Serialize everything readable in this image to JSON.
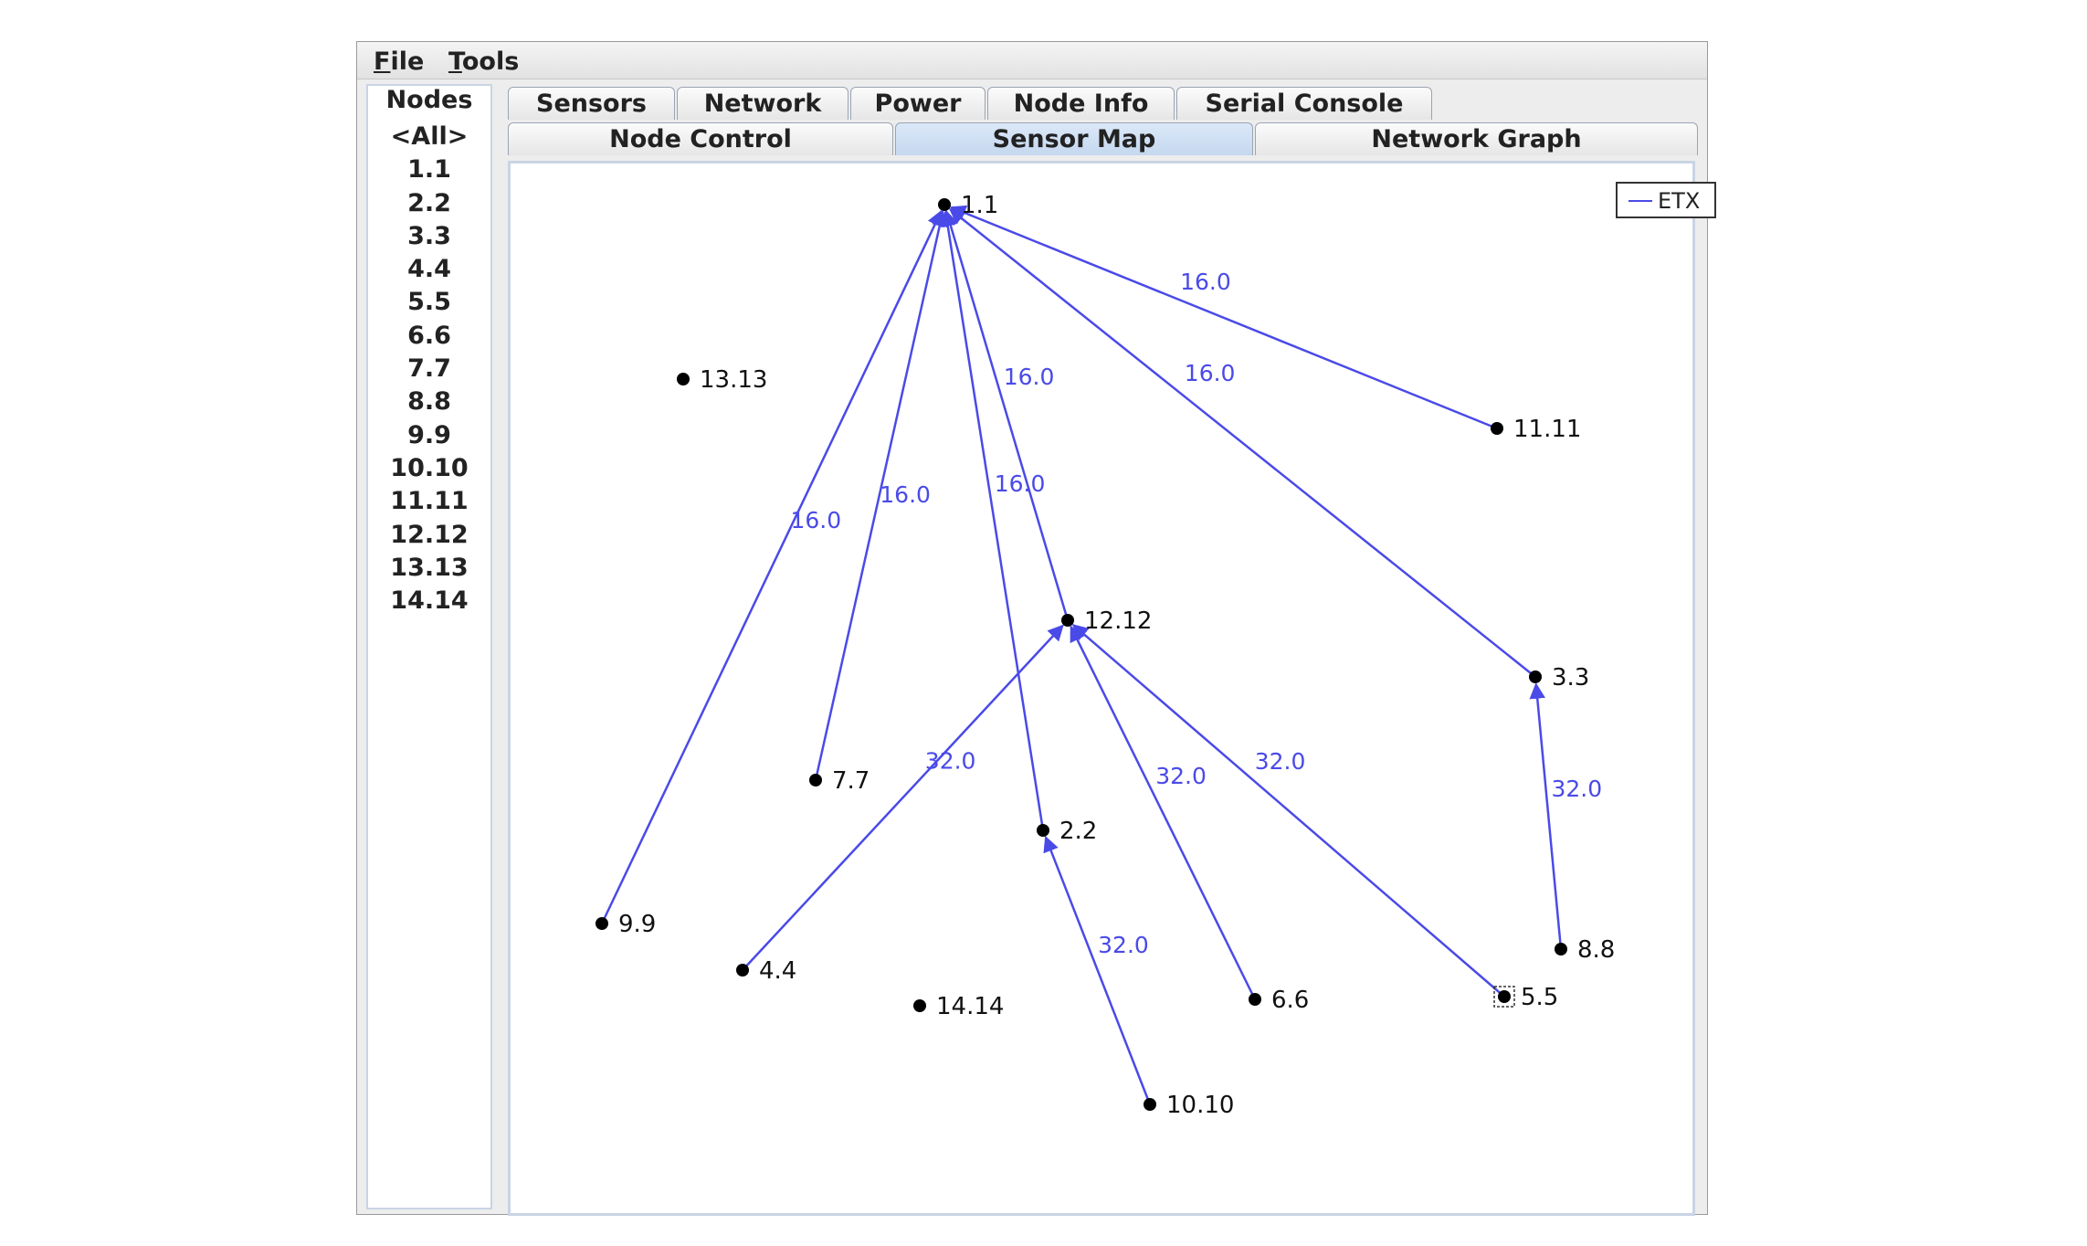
{
  "menubar": {
    "file": "File",
    "tools": "Tools"
  },
  "nodes_panel": {
    "title": "Nodes",
    "items": [
      "<All>",
      "1.1",
      "2.2",
      "3.3",
      "4.4",
      "5.5",
      "6.6",
      "7.7",
      "8.8",
      "9.9",
      "10.10",
      "11.11",
      "12.12",
      "13.13",
      "14.14"
    ]
  },
  "tabs_top": [
    "Sensors",
    "Network",
    "Power",
    "Node Info",
    "Serial Console"
  ],
  "tabs_bottom": [
    "Node Control",
    "Sensor Map",
    "Network Graph"
  ],
  "selected_tab": "Sensor Map",
  "legend": {
    "label": "ETX",
    "color": "#4a4ae8"
  },
  "graph": {
    "nodes": [
      {
        "id": "1.1"
      },
      {
        "id": "13.13"
      },
      {
        "id": "11.11"
      },
      {
        "id": "12.12"
      },
      {
        "id": "3.3"
      },
      {
        "id": "7.7"
      },
      {
        "id": "2.2"
      },
      {
        "id": "8.8"
      },
      {
        "id": "9.9"
      },
      {
        "id": "4.4"
      },
      {
        "id": "14.14"
      },
      {
        "id": "6.6"
      },
      {
        "id": "5.5"
      },
      {
        "id": "10.10"
      }
    ],
    "edges": [
      {
        "from": "11.11",
        "to": "1.1",
        "etx": "16.0"
      },
      {
        "from": "3.3",
        "to": "1.1",
        "etx": "16.0"
      },
      {
        "from": "12.12",
        "to": "1.1",
        "etx": "16.0"
      },
      {
        "from": "2.2",
        "to": "1.1",
        "etx": "16.0"
      },
      {
        "from": "7.7",
        "to": "1.1",
        "etx": "16.0"
      },
      {
        "from": "9.9",
        "to": "1.1",
        "etx": "16.0"
      },
      {
        "from": "4.4",
        "to": "12.12",
        "etx": "32.0"
      },
      {
        "from": "6.6",
        "to": "12.12",
        "etx": "32.0"
      },
      {
        "from": "5.5",
        "to": "12.12",
        "etx": "32.0"
      },
      {
        "from": "8.8",
        "to": "3.3",
        "etx": "32.0"
      },
      {
        "from": "10.10",
        "to": "2.2",
        "etx": "32.0"
      }
    ],
    "selected_node": "5.5"
  }
}
